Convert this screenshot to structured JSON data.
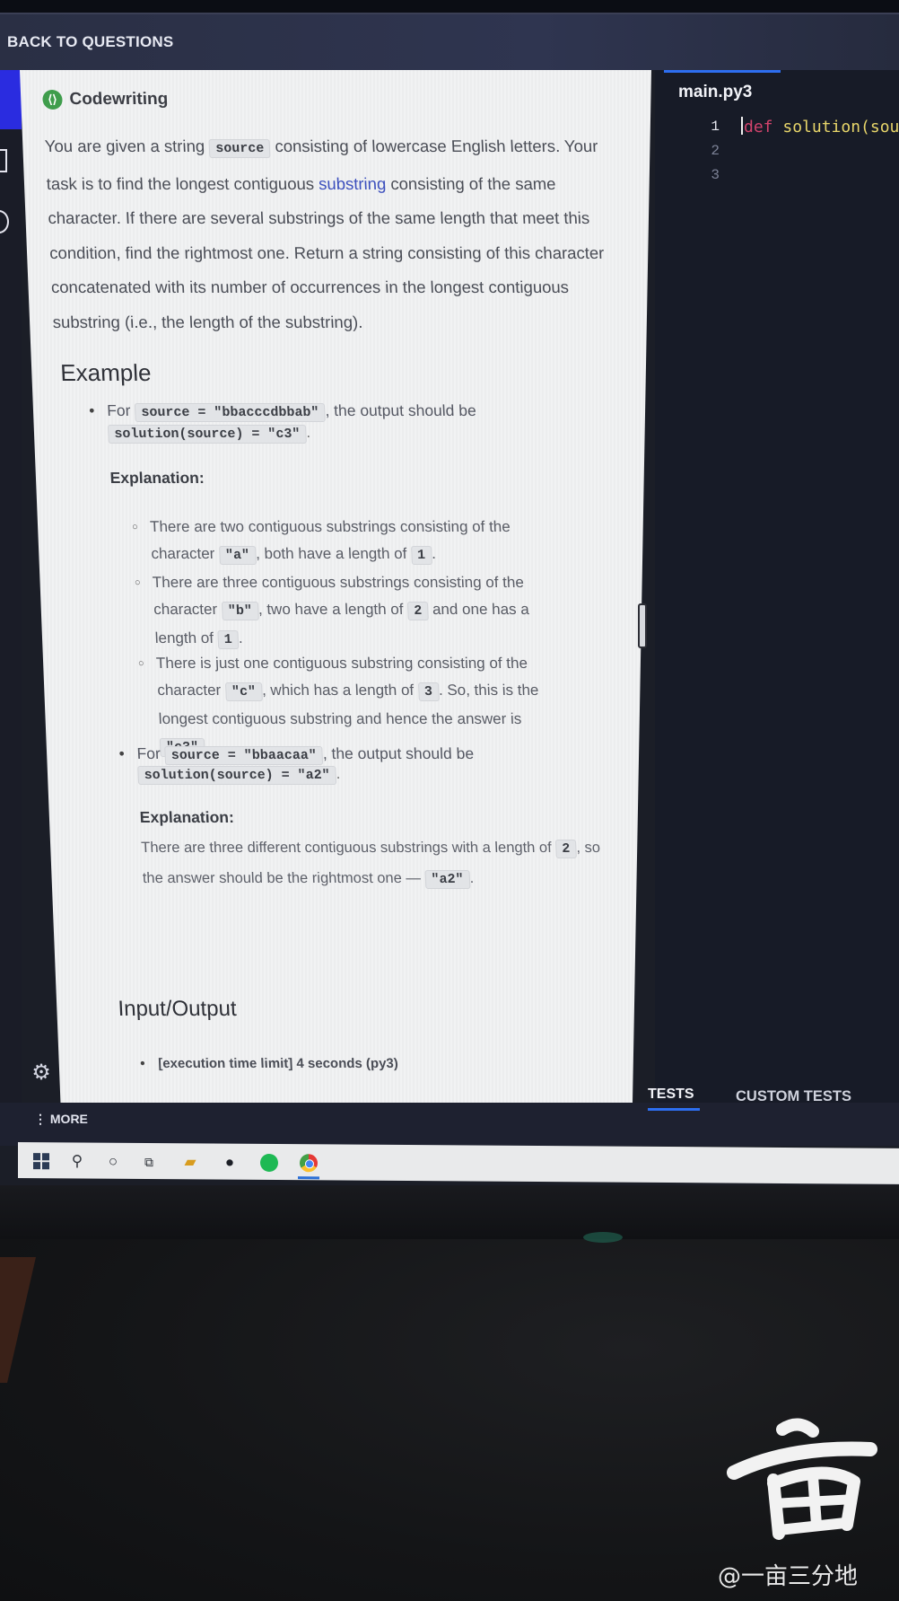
{
  "header": {
    "back_label": "BACK TO QUESTIONS"
  },
  "task": {
    "type_label": "Codewriting",
    "description": {
      "p1_before": "You are given a string ",
      "p1_code": "source",
      "p1_after": " consisting of lowercase English letters. Your task is to find the longest contiguous ",
      "p1_link": "substring",
      "p1_end": " consisting of the same character. If there are several substrings of the same length that meet this condition, find the rightmost one. Return a string consisting of this character concatenated with its number of occurrences in the longest contiguous substring (i.e., the length of the substring)."
    },
    "example_heading": "Example",
    "examples": [
      {
        "for_label": "For",
        "input_code": "source = \"bbacccdbbab\"",
        "output_label": ", the output should be",
        "output_code": "solution(source) = \"c3\"",
        "explanation_label": "Explanation:",
        "points": [
          {
            "t1": "There are two contiguous substrings consisting of the character ",
            "c1": "\"a\"",
            "t2": ", both have a length of ",
            "c2": "1",
            "t3": "."
          },
          {
            "t1": "There are three contiguous substrings consisting of the character ",
            "c1": "\"b\"",
            "t2": ", two have a length of ",
            "c2": "2",
            "t3": " and one has a length of ",
            "c3": "1",
            "t4": "."
          },
          {
            "t1": "There is just one contiguous substring consisting of the character ",
            "c1": "\"c\"",
            "t2": ", which has a length of ",
            "c2": "3",
            "t3": ". So, this is the longest contiguous substring and hence the answer is ",
            "c3": "\"c3\"",
            "t4": "."
          }
        ]
      },
      {
        "for_label": "For",
        "input_code": "source = \"bbaacaa\"",
        "output_label": ", the output should be",
        "output_code": "solution(source) = \"a2\"",
        "explanation_label": "Explanation:",
        "text1": "There are three different contiguous substrings with a length of ",
        "code1": "2",
        "text2": ", so the answer should be the rightmost one — ",
        "code2": "\"a2\"",
        "text3": "."
      }
    ],
    "io_heading": "Input/Output",
    "io_items": [
      "[execution time limit] 4 seconds (py3)"
    ]
  },
  "editor": {
    "filename": "main.py3",
    "line_numbers": [
      "1",
      "2",
      "3"
    ],
    "code_keyword": "def",
    "code_rest": " solution(sour"
  },
  "tests_panel": {
    "tests_label": "TESTS",
    "custom_tests_label": "CUSTOM TESTS"
  },
  "bottom": {
    "more_label": "MORE"
  },
  "taskbar": {
    "icons": [
      "windows-start-icon",
      "search-icon",
      "cortana-icon",
      "task-view-icon",
      "file-explorer-icon",
      "alienware-icon",
      "spotify-icon",
      "chrome-icon"
    ]
  },
  "watermark": {
    "text": "@一亩三分地",
    "seal_text": "亩"
  },
  "colors": {
    "accent_blue": "#2d6ef0",
    "link_blue": "#3c4fbd",
    "keyword_pink": "#d2436c",
    "codewriting_green": "#3f9d4c"
  }
}
